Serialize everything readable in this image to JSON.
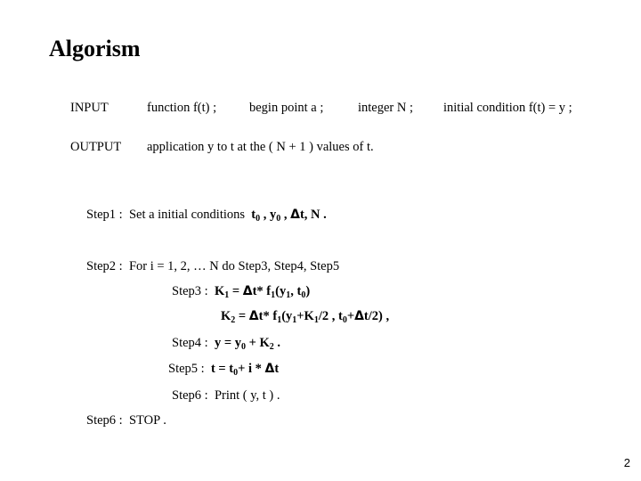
{
  "title": "Algorism",
  "input": {
    "label": "INPUT",
    "items": [
      "function f(t) ;",
      "begin point a ;",
      "integer N ;",
      "initial condition  f(t) = y ;"
    ]
  },
  "output": {
    "label": "OUTPUT",
    "text": "application y to t at the ( N + 1 ) values of t."
  },
  "steps": {
    "step1": {
      "label": "Step1  :",
      "text": "Set a initial conditions",
      "vars": [
        "t",
        "0",
        " ,  y",
        "0",
        " , ",
        "Δ",
        "t,  N ."
      ]
    },
    "step2": {
      "label": "Step2  :",
      "text": "For  i = 1, 2, … N do Step3, Step4, Step5"
    },
    "step3": {
      "label": "Step3  :",
      "k1": [
        "K",
        "1",
        " = ",
        "Δ",
        "t* f",
        "1",
        "(y",
        "1",
        ", t",
        "0",
        ")"
      ]
    },
    "step3b": {
      "k2": [
        "K",
        "2",
        " = ",
        "Δ",
        "t* f",
        "1",
        "(y",
        "1",
        "+K",
        "1",
        "/2 ,  t",
        "0",
        "+",
        "Δ",
        "t/2) ,"
      ]
    },
    "step4": {
      "label": "Step4  :",
      "eq": [
        "y = y",
        "0",
        " +  K",
        "2",
        " ."
      ]
    },
    "step5": {
      "label": "Step5  :",
      "eq": [
        "t = t",
        "0",
        "+ i * ",
        "Δ",
        "t"
      ]
    },
    "step6": {
      "label": "Step6  :",
      "text": "Print ( y,  t ) ."
    },
    "step6b": {
      "label": "Step6  :",
      "text": "STOP ."
    }
  },
  "page_number": "2"
}
